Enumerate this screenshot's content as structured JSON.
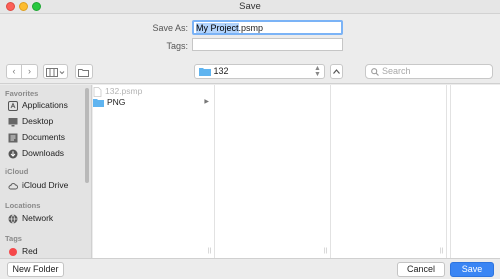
{
  "window": {
    "title": "Save"
  },
  "form": {
    "save_as_label": "Save As:",
    "filename_selected": "My Project",
    "filename_ext": ".psmp",
    "tags_label": "Tags:",
    "tags_value": ""
  },
  "toolbar": {
    "back_glyph": "‹",
    "forward_glyph": "›",
    "current_folder": "132",
    "search_placeholder": "Search"
  },
  "sidebar": {
    "sections": [
      {
        "title": "Favorites",
        "items": [
          {
            "label": "Applications",
            "icon": "applications-icon"
          },
          {
            "label": "Desktop",
            "icon": "desktop-icon"
          },
          {
            "label": "Documents",
            "icon": "documents-icon"
          },
          {
            "label": "Downloads",
            "icon": "downloads-icon"
          }
        ]
      },
      {
        "title": "iCloud",
        "items": [
          {
            "label": "iCloud Drive",
            "icon": "cloud-icon"
          }
        ]
      },
      {
        "title": "Locations",
        "items": [
          {
            "label": "Network",
            "icon": "globe-icon"
          }
        ]
      },
      {
        "title": "Tags",
        "items": [
          {
            "label": "Red",
            "icon": "red-tag-icon",
            "color": "#f5484a"
          }
        ]
      }
    ]
  },
  "browser": {
    "column1": [
      {
        "name": "132.psmp",
        "kind": "file",
        "dimmed": true
      },
      {
        "name": "PNG",
        "kind": "folder",
        "dimmed": false,
        "has_children": true
      }
    ]
  },
  "footer": {
    "new_folder_label": "New Folder",
    "cancel_label": "Cancel",
    "save_label": "Save"
  },
  "colors": {
    "accent": "#3a85f4",
    "folder": "#5fb4f0",
    "selection": "#b3d4fc"
  }
}
